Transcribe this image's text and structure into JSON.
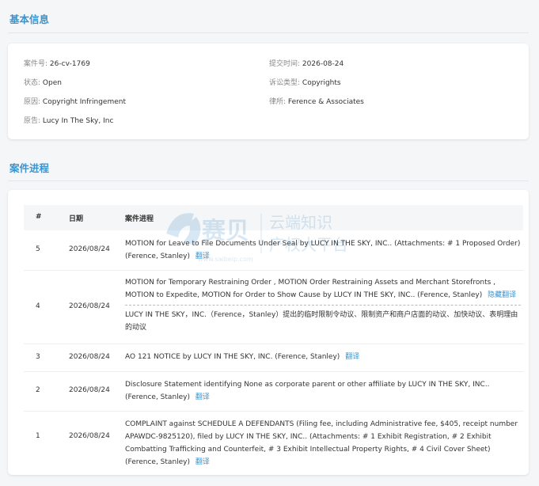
{
  "basic_info": {
    "title": "基本信息",
    "case_no_label": "案件号:",
    "case_no": "26-cv-1769",
    "status_label": "状态:",
    "status": "Open",
    "cause_label": "原因:",
    "cause": "Copyright Infringement",
    "plaintiff_label": "原告:",
    "plaintiff": "Lucy In The Sky, Inc",
    "filed_label": "提交时间:",
    "filed": "2026-08-24",
    "type_label": "诉讼类型:",
    "type": "Copyrights",
    "firm_label": "律所:",
    "firm": "Ference & Associates"
  },
  "progress": {
    "title": "案件进程",
    "headers": {
      "num": "#",
      "date": "日期",
      "progress": "案件进程"
    },
    "rows": [
      {
        "num": "5",
        "date": "2026/08/24",
        "text": "MOTION for Leave to File Documents Under Seal by LUCY IN THE SKY, INC.. (Attachments: # 1 Proposed Order) (Ference, Stanley)",
        "link": "翻译"
      },
      {
        "num": "4",
        "date": "2026/08/24",
        "text": "MOTION for Temporary Restraining Order , MOTION Order Restraining Assets and Merchant Storefronts , MOTION to Expedite, MOTION for Order to Show Cause by LUCY IN THE SKY, INC.. (Ference, Stanley)",
        "link": "隐藏翻译",
        "translation": "LUCY IN THE SKY，INC.（Ference，Stanley）提出的临时限制令动议、限制资产和商户店面的动议、加快动议、表明理由的动议"
      },
      {
        "num": "3",
        "date": "2026/08/24",
        "text": "AO 121 NOTICE by LUCY IN THE SKY, INC. (Ference, Stanley)",
        "link": "翻译"
      },
      {
        "num": "2",
        "date": "2026/08/24",
        "text": "Disclosure Statement identifying None as corporate parent or other affiliate by LUCY IN THE SKY, INC.. (Ference, Stanley)",
        "link": "翻译"
      },
      {
        "num": "1",
        "date": "2026/08/24",
        "text": "COMPLAINT against SCHEDULE A DEFENDANTS (Filing fee, including Administrative fee, $405, receipt number APAWDC-9825120), filed by LUCY IN THE SKY, INC.. (Attachments: # 1 Exhibit Registration, # 2 Exhibit Combatting Trafficking and Counterfeit, # 3 Exhibit Intellectual Property Rights, # 4 Civil Cover Sheet) (Ference, Stanley)",
        "link": "翻译"
      }
    ]
  },
  "watermark": {
    "brand": "赛贝",
    "line1": "云端知识",
    "line2": "产权大平台",
    "url": "www.saibeip.com"
  }
}
